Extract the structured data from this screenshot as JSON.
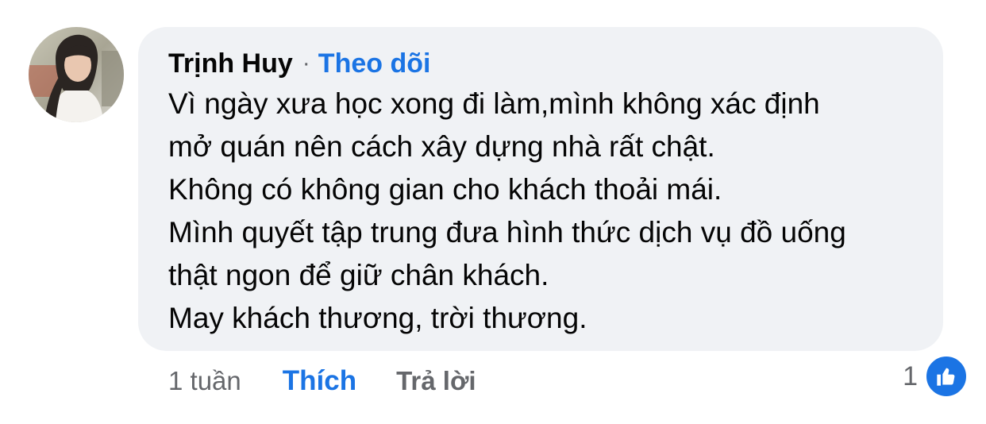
{
  "comment": {
    "author": "Trịnh Huy",
    "separator": "·",
    "follow_label": "Theo dõi",
    "avatar_icon": "profile-photo",
    "lines": [
      "Vì ngày xưa học xong đi làm,mình không xác định",
      "mở quán nên cách xây dựng nhà rất chật.",
      "Không có không gian cho khách thoải mái.",
      "Mình quyết tập trung đưa hình thức dịch vụ đồ uống",
      "thật ngon để giữ chân khách.",
      "May khách thương, trời thương."
    ]
  },
  "actions": {
    "time": "1 tuần",
    "like_label": "Thích",
    "reply_label": "Trả lời"
  },
  "reactions": {
    "count": "1",
    "icon": "thumbs-up-icon"
  },
  "colors": {
    "bubble": "#f0f2f5",
    "accent": "#1b74e4",
    "secondary_text": "#65676b",
    "primary_text": "#050505"
  }
}
